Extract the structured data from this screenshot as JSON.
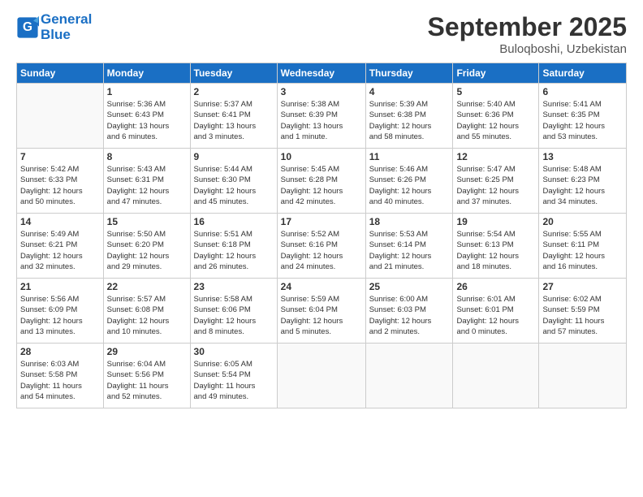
{
  "header": {
    "logo_line1": "General",
    "logo_line2": "Blue",
    "month": "September 2025",
    "location": "Buloqboshi, Uzbekistan"
  },
  "days_of_week": [
    "Sunday",
    "Monday",
    "Tuesday",
    "Wednesday",
    "Thursday",
    "Friday",
    "Saturday"
  ],
  "weeks": [
    [
      {
        "num": "",
        "info": ""
      },
      {
        "num": "1",
        "info": "Sunrise: 5:36 AM\nSunset: 6:43 PM\nDaylight: 13 hours\nand 6 minutes."
      },
      {
        "num": "2",
        "info": "Sunrise: 5:37 AM\nSunset: 6:41 PM\nDaylight: 13 hours\nand 3 minutes."
      },
      {
        "num": "3",
        "info": "Sunrise: 5:38 AM\nSunset: 6:39 PM\nDaylight: 13 hours\nand 1 minute."
      },
      {
        "num": "4",
        "info": "Sunrise: 5:39 AM\nSunset: 6:38 PM\nDaylight: 12 hours\nand 58 minutes."
      },
      {
        "num": "5",
        "info": "Sunrise: 5:40 AM\nSunset: 6:36 PM\nDaylight: 12 hours\nand 55 minutes."
      },
      {
        "num": "6",
        "info": "Sunrise: 5:41 AM\nSunset: 6:35 PM\nDaylight: 12 hours\nand 53 minutes."
      }
    ],
    [
      {
        "num": "7",
        "info": "Sunrise: 5:42 AM\nSunset: 6:33 PM\nDaylight: 12 hours\nand 50 minutes."
      },
      {
        "num": "8",
        "info": "Sunrise: 5:43 AM\nSunset: 6:31 PM\nDaylight: 12 hours\nand 47 minutes."
      },
      {
        "num": "9",
        "info": "Sunrise: 5:44 AM\nSunset: 6:30 PM\nDaylight: 12 hours\nand 45 minutes."
      },
      {
        "num": "10",
        "info": "Sunrise: 5:45 AM\nSunset: 6:28 PM\nDaylight: 12 hours\nand 42 minutes."
      },
      {
        "num": "11",
        "info": "Sunrise: 5:46 AM\nSunset: 6:26 PM\nDaylight: 12 hours\nand 40 minutes."
      },
      {
        "num": "12",
        "info": "Sunrise: 5:47 AM\nSunset: 6:25 PM\nDaylight: 12 hours\nand 37 minutes."
      },
      {
        "num": "13",
        "info": "Sunrise: 5:48 AM\nSunset: 6:23 PM\nDaylight: 12 hours\nand 34 minutes."
      }
    ],
    [
      {
        "num": "14",
        "info": "Sunrise: 5:49 AM\nSunset: 6:21 PM\nDaylight: 12 hours\nand 32 minutes."
      },
      {
        "num": "15",
        "info": "Sunrise: 5:50 AM\nSunset: 6:20 PM\nDaylight: 12 hours\nand 29 minutes."
      },
      {
        "num": "16",
        "info": "Sunrise: 5:51 AM\nSunset: 6:18 PM\nDaylight: 12 hours\nand 26 minutes."
      },
      {
        "num": "17",
        "info": "Sunrise: 5:52 AM\nSunset: 6:16 PM\nDaylight: 12 hours\nand 24 minutes."
      },
      {
        "num": "18",
        "info": "Sunrise: 5:53 AM\nSunset: 6:14 PM\nDaylight: 12 hours\nand 21 minutes."
      },
      {
        "num": "19",
        "info": "Sunrise: 5:54 AM\nSunset: 6:13 PM\nDaylight: 12 hours\nand 18 minutes."
      },
      {
        "num": "20",
        "info": "Sunrise: 5:55 AM\nSunset: 6:11 PM\nDaylight: 12 hours\nand 16 minutes."
      }
    ],
    [
      {
        "num": "21",
        "info": "Sunrise: 5:56 AM\nSunset: 6:09 PM\nDaylight: 12 hours\nand 13 minutes."
      },
      {
        "num": "22",
        "info": "Sunrise: 5:57 AM\nSunset: 6:08 PM\nDaylight: 12 hours\nand 10 minutes."
      },
      {
        "num": "23",
        "info": "Sunrise: 5:58 AM\nSunset: 6:06 PM\nDaylight: 12 hours\nand 8 minutes."
      },
      {
        "num": "24",
        "info": "Sunrise: 5:59 AM\nSunset: 6:04 PM\nDaylight: 12 hours\nand 5 minutes."
      },
      {
        "num": "25",
        "info": "Sunrise: 6:00 AM\nSunset: 6:03 PM\nDaylight: 12 hours\nand 2 minutes."
      },
      {
        "num": "26",
        "info": "Sunrise: 6:01 AM\nSunset: 6:01 PM\nDaylight: 12 hours\nand 0 minutes."
      },
      {
        "num": "27",
        "info": "Sunrise: 6:02 AM\nSunset: 5:59 PM\nDaylight: 11 hours\nand 57 minutes."
      }
    ],
    [
      {
        "num": "28",
        "info": "Sunrise: 6:03 AM\nSunset: 5:58 PM\nDaylight: 11 hours\nand 54 minutes."
      },
      {
        "num": "29",
        "info": "Sunrise: 6:04 AM\nSunset: 5:56 PM\nDaylight: 11 hours\nand 52 minutes."
      },
      {
        "num": "30",
        "info": "Sunrise: 6:05 AM\nSunset: 5:54 PM\nDaylight: 11 hours\nand 49 minutes."
      },
      {
        "num": "",
        "info": ""
      },
      {
        "num": "",
        "info": ""
      },
      {
        "num": "",
        "info": ""
      },
      {
        "num": "",
        "info": ""
      }
    ]
  ]
}
